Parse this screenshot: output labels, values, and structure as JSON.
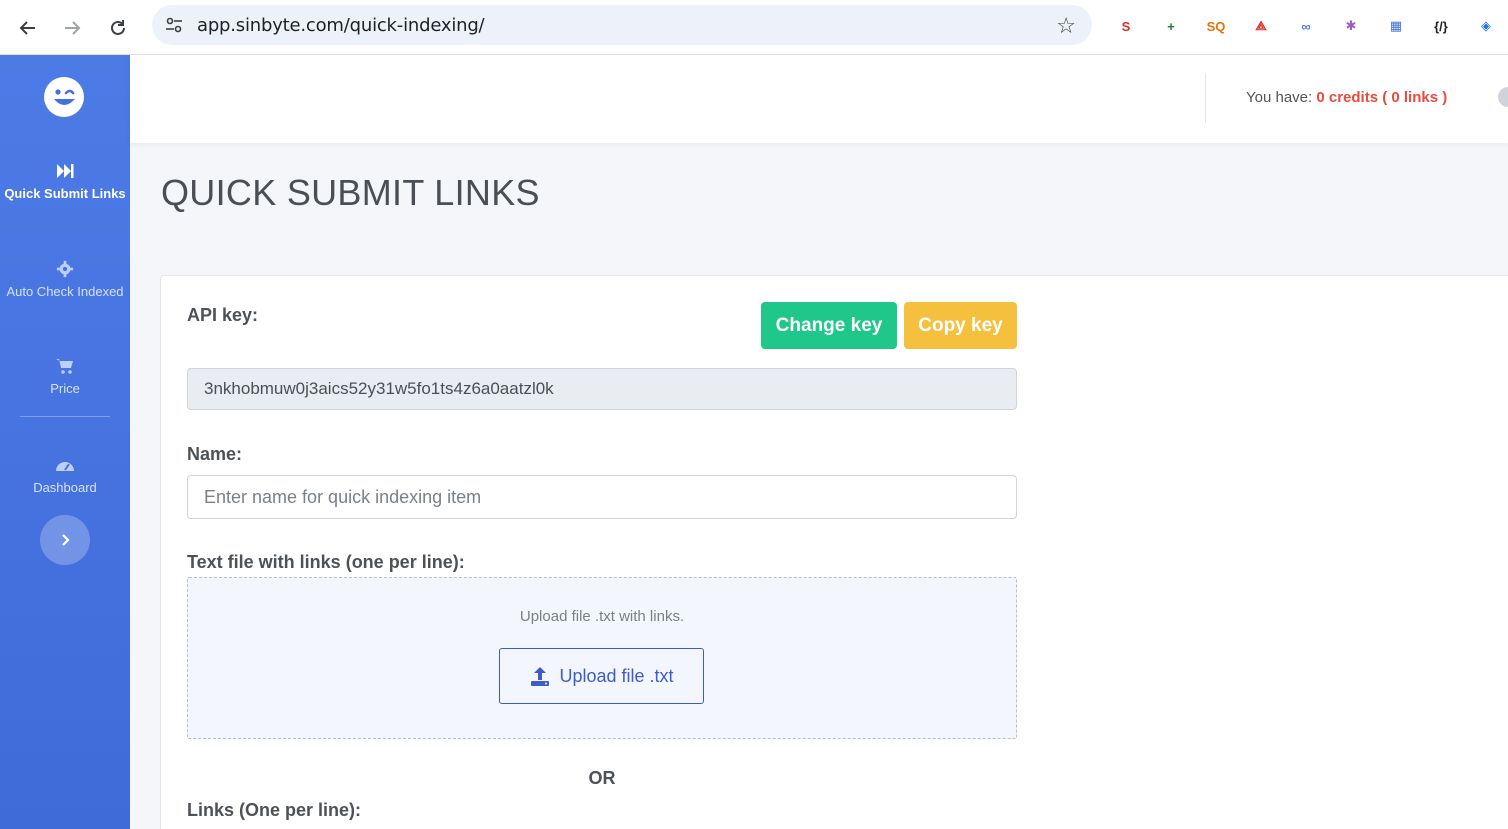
{
  "browser": {
    "url": "app.sinbyte.com/quick-indexing/",
    "extensions": [
      {
        "icon": "seo-extension-icon",
        "label": "S",
        "color": "#d93025"
      },
      {
        "icon": "add-extension-icon",
        "label": "+",
        "color": "#188038"
      },
      {
        "icon": "seoquake-extension-icon",
        "label": "SQ",
        "color": "#e8710a"
      },
      {
        "icon": "acrobat-extension-icon",
        "label": "⟁",
        "color": "#d93025"
      },
      {
        "icon": "link-extension-icon",
        "label": "∞",
        "color": "#4a7bd6"
      },
      {
        "icon": "gear-extension-icon",
        "label": "✱",
        "color": "#9b59d0"
      },
      {
        "icon": "calendar-extension-icon",
        "label": "▦",
        "color": "#3b6fd1"
      },
      {
        "icon": "code-extension-icon",
        "label": "{/}",
        "color": "#202124"
      },
      {
        "icon": "tag-extension-icon",
        "label": "◈",
        "color": "#1a73e8"
      }
    ]
  },
  "sidebar": {
    "items": [
      {
        "label": "Quick Submit Links",
        "icon": "fast-forward-icon",
        "active": true
      },
      {
        "label": "Auto Check Indexed",
        "icon": "gear-icon",
        "active": false
      },
      {
        "label": "Price",
        "icon": "cart-icon",
        "active": false
      },
      {
        "label": "Dashboard",
        "icon": "dashboard-icon",
        "active": false
      }
    ]
  },
  "header": {
    "credits_prefix": "You have: ",
    "credits_value": "0 credits ( 0 links )"
  },
  "page": {
    "title": "QUICK SUBMIT LINKS"
  },
  "form": {
    "api_key_label": "API key:",
    "change_key_label": "Change key",
    "copy_key_label": "Copy key",
    "api_key_value": "3nkhobmuw0j3aics52y31w5fo1ts4z6a0aatzl0k",
    "name_label": "Name:",
    "name_placeholder": "Enter name for quick indexing item",
    "file_label": "Text file with links (one per line):",
    "dropzone_text": "Upload file .txt with links.",
    "upload_button_label": "Upload file .txt",
    "or_label": "OR",
    "links_label": "Links (One per line):"
  },
  "colors": {
    "sidebar": "#4570e0",
    "green_button": "#1fc78a",
    "yellow_button": "#f6c03f",
    "credits_red": "#e74c3c",
    "upload_blue": "#3f5bc9"
  }
}
